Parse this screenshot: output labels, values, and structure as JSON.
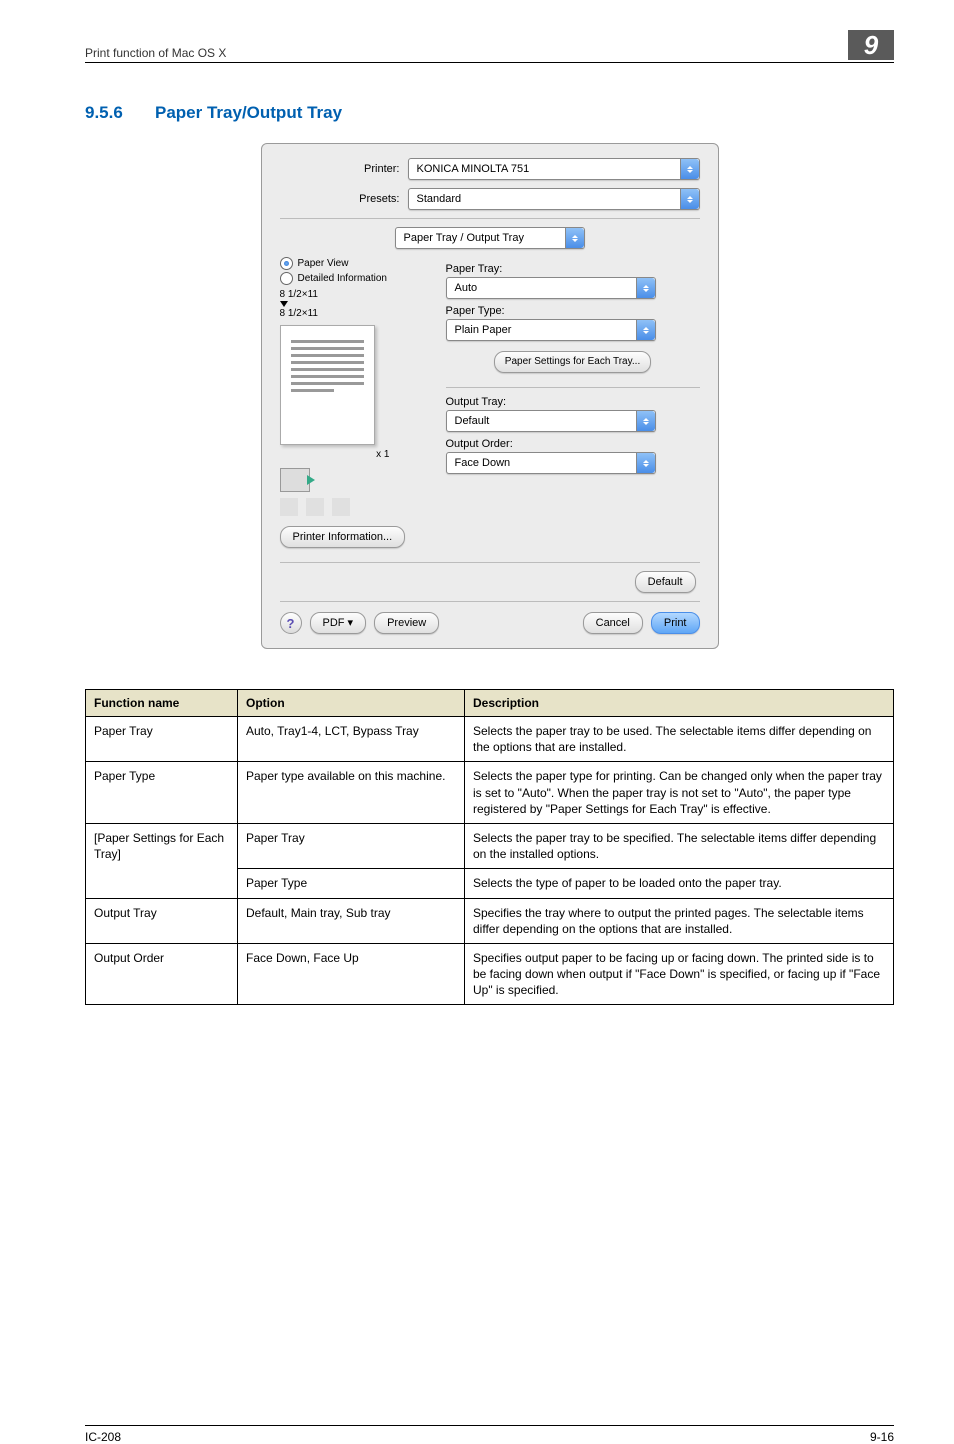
{
  "header": {
    "breadcrumb": "Print function of Mac OS X",
    "chapter_number": "9"
  },
  "section": {
    "number": "9.5.6",
    "title": "Paper Tray/Output Tray"
  },
  "dialog": {
    "printer_label": "Printer:",
    "printer_value": "KONICA MINOLTA 751",
    "presets_label": "Presets:",
    "presets_value": "Standard",
    "pane_value": "Paper Tray / Output Tray",
    "view_paper": "Paper View",
    "view_detailed": "Detailed Information",
    "size_top": "8 1/2×11",
    "size_bottom": "8 1/2×11",
    "x1": "x 1",
    "printer_info_btn": "Printer Information...",
    "right": {
      "paper_tray_label": "Paper Tray:",
      "paper_tray_value": "Auto",
      "paper_type_label": "Paper Type:",
      "paper_type_value": "Plain Paper",
      "settings_btn": "Paper Settings for Each Tray...",
      "output_tray_label": "Output Tray:",
      "output_tray_value": "Default",
      "output_order_label": "Output Order:",
      "output_order_value": "Face Down"
    },
    "default_btn": "Default",
    "footer": {
      "help": "?",
      "pdf": "PDF ▾",
      "preview": "Preview",
      "cancel": "Cancel",
      "print": "Print"
    }
  },
  "table": {
    "headers": {
      "func": "Function name",
      "option": "Option",
      "desc": "Description"
    },
    "rows": [
      {
        "func": "Paper Tray",
        "option": "Auto, Tray1-4, LCT, Bypass Tray",
        "desc": "Selects the paper tray to be used.\nThe selectable items differ depending on the options that are installed."
      },
      {
        "func": "Paper Type",
        "option": "Paper type available on this machine.",
        "desc": "Selects the paper type for printing.\nCan be changed only when the paper tray is set to \"Auto\". When the paper tray is not set to \"Auto\", the paper type registered by \"Paper Settings for Each Tray\" is effective."
      },
      {
        "func": "[Paper Settings for Each Tray]",
        "option": "Paper Tray",
        "desc": "Selects the paper tray to be specified.\nThe selectable items differ depending on the installed options."
      },
      {
        "func": "",
        "option": "Paper Type",
        "desc": "Selects the type of paper to be loaded onto the paper tray."
      },
      {
        "func": "Output Tray",
        "option": "Default, Main tray, Sub tray",
        "desc": "Specifies the tray where to output the printed pages.\nThe selectable items differ depending on the options that are installed."
      },
      {
        "func": "Output Order",
        "option": "Face Down, Face Up",
        "desc": "Specifies output paper to be facing up or facing down. The printed side is to be facing down when output if \"Face Down\" is specified, or facing up if \"Face Up\" is specified."
      }
    ]
  },
  "footer": {
    "left": "IC-208",
    "right": "9-16"
  }
}
